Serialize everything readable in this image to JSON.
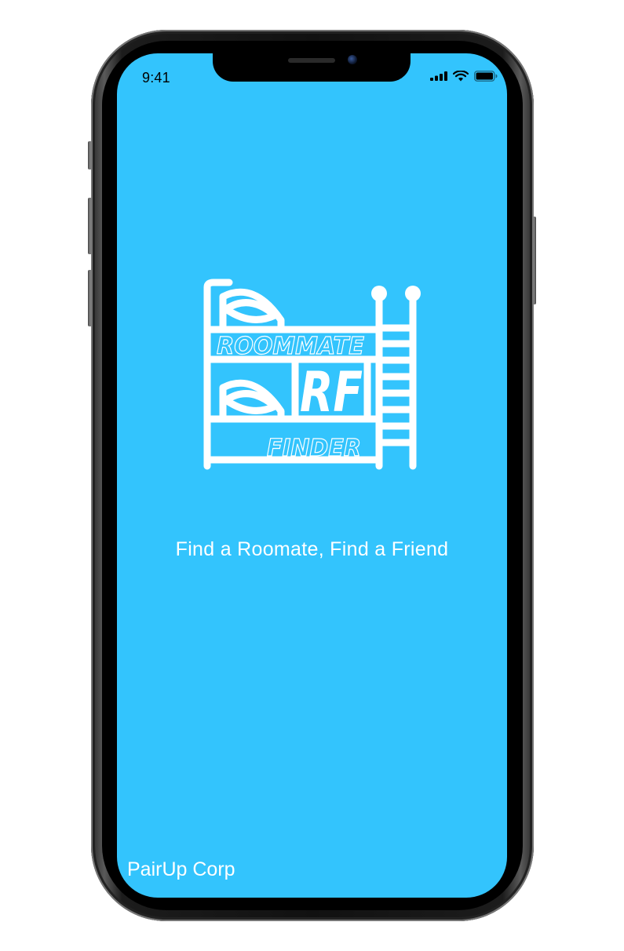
{
  "status_bar": {
    "time": "9:41",
    "icons": [
      "signal-icon",
      "wifi-icon",
      "battery-icon"
    ]
  },
  "logo": {
    "icon": "bunk-bed-logo-icon",
    "line1": "ROOMMATE",
    "monogram": "RF",
    "line2": "FINDER"
  },
  "tagline": "Find a Roomate, Find a Friend",
  "footer": "PairUp Corp",
  "colors": {
    "background": "#33c4fd",
    "foreground": "#ffffff"
  }
}
